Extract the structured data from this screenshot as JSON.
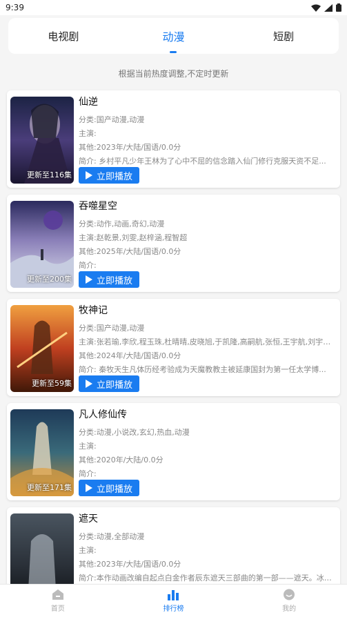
{
  "status_bar": {
    "time": "9:39"
  },
  "tabs": [
    {
      "label": "电视剧",
      "active": false
    },
    {
      "label": "动漫",
      "active": true
    },
    {
      "label": "短剧",
      "active": false
    }
  ],
  "subtitle": "根据当前热度调整,不定时更新",
  "play_label": "立即播放",
  "items": [
    {
      "title": "仙逆",
      "category": "分类:国产动漫,动漫",
      "cast": "主演:",
      "other": "其他:2023年/大陆/国语/0.0分",
      "summary": "简介:        乡村平凡少年王林为了心中不屈的信念踏入仙门修行克服天资不足...",
      "badge": "更新至116集"
    },
    {
      "title": "吞噬星空",
      "category": "分类:动作,动画,奇幻,动漫",
      "cast": "主演:赵乾景,刘雯,赵梓涵,程智超",
      "other": "其他:2025年/大陆/国语/0.0分",
      "summary": "简介:",
      "badge": "更新至200集"
    },
    {
      "title": "牧神记",
      "category": "分类:国产动漫,动漫",
      "cast": "主演:张若瑜,李欣,程玉珠,杜晴晴,皮晓旭,于凯隆,高嗣航,张恒,王宇航,刘宇轩,唐...",
      "other": "其他:2024年/大陆/国语/0.0分",
      "summary": "简介:        秦牧天生凡体历经考验成为天魔教教主被延康国封为第一任太学博...",
      "badge": "更新至59集"
    },
    {
      "title": "凡人修仙传",
      "category": "分类:动漫,小说改,玄幻,热血,动漫",
      "cast": "主演:",
      "other": "其他:2020年/大陆/0.0分",
      "summary": "简介:",
      "badge": "更新至171集"
    },
    {
      "title": "遮天",
      "category": "分类:动漫,全部动漫",
      "cast": "主演:",
      "other": "其他:2023年/大陆/国语/0.0分",
      "summary": "简介:本作动画改编自起点白金作者辰东遮天三部曲的第一部——遮天。冰冷...",
      "badge": ""
    }
  ],
  "bottom_nav": [
    {
      "label": "首页",
      "icon": "home-icon",
      "active": false
    },
    {
      "label": "排行榜",
      "icon": "ranking-icon",
      "active": true
    },
    {
      "label": "我的",
      "icon": "profile-icon",
      "active": false
    }
  ],
  "colors": {
    "accent": "#1a7cf0",
    "background": "#f5f5f5"
  }
}
